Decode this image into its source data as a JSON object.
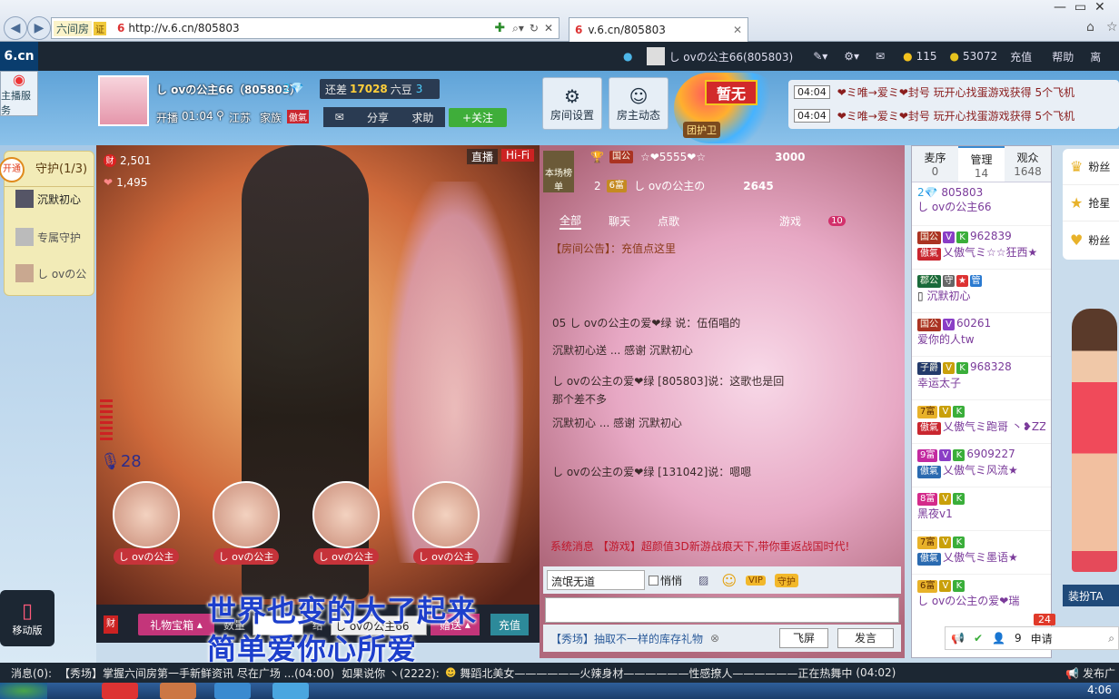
{
  "browser": {
    "fav_label": "六间房",
    "fav_badge": "证",
    "url": "http://v.6.cn/805803",
    "tab_title": "v.6.cn/805803"
  },
  "site": {
    "logo": "6.cn",
    "user": "し ovの公主66(805803)",
    "coins": "115",
    "beans": "53072",
    "recharge": "充值",
    "help": "帮助",
    "exit": "离"
  },
  "room": {
    "service": "主播服务",
    "name": "し ovの公主66（805803）",
    "diff_prefix": "还差",
    "diff_value": "17028",
    "diff_suffix": "六豆",
    "level": "3",
    "live_label": "开播",
    "live_time": "01:04",
    "location": "江苏",
    "family": "家族",
    "family_tag": "傲氣",
    "share": "分享",
    "request": "求助",
    "follow": "+关注",
    "btn_room_settings": "房间设置",
    "btn_host_feed": "房主动态",
    "no_guard": "暂无",
    "guard_group": "团护卫",
    "notices": [
      {
        "time": "04:04",
        "text": "❤ミ唯→爱ミ❤封号 玩开心找蛋游戏获得 5个飞机"
      },
      {
        "time": "04:04",
        "text": "❤ミ唯→爱ミ❤封号 玩开心找蛋游戏获得 5个飞机"
      }
    ]
  },
  "guard": {
    "open": "开通",
    "title": "守护(1/3)",
    "items": [
      "沉默初心",
      "专属守护",
      "し ovの公"
    ]
  },
  "video": {
    "wealth": "2,501",
    "hearts": "1,495",
    "live_tag": "直播",
    "hifi_tag": "Hi-Fi",
    "mic_count": "28",
    "gift_names": [
      "し ovの公主",
      "し ovの公主",
      "し ovの公主",
      "し ovの公主"
    ],
    "lyric1": "世界也变的大了起来",
    "lyric2": "简单爱你心所爱",
    "gift_box": "礼物宝箱",
    "qty_label": "数量",
    "to_label": "给",
    "recipient": "し ovの公主66",
    "send": "赠送",
    "recharge": "充值"
  },
  "rank": {
    "label": "本场榜单",
    "first_badge": "国公",
    "first_name": "☆❤5555❤☆",
    "first_score": "3000",
    "second_num": "2",
    "second_badge": "6富",
    "second_name": "し ovの公主の",
    "second_score": "2645"
  },
  "chat": {
    "tabs": [
      "全部",
      "聊天",
      "点歌",
      "游戏"
    ],
    "tab_count": "10",
    "announce": "【房间公告】：充值点这里",
    "messages": [
      "05 し ovの公主の爱❤绿   说：伍佰唱的",
      "沉默初心送 ...                     感谢 沉默初心",
      "し ovの公主の爱❤绿 [805803]说：这歌也是回",
      "那个差不多",
      "沉默初心 ...                         感谢 沉默初心",
      "し ovの公主の爱❤绿 [131042]说：嗯嗯"
    ],
    "system": "系统消息 【游戏】超颜值3D新游战痕天下,带你重返战国时代!",
    "target": "流氓无道",
    "whisper": "悄悄",
    "vip": "VIP",
    "guard_btn": "守护",
    "promo": "【秀场】抽取不一样的库存礼物",
    "fly": "飞屏",
    "send": "发言"
  },
  "users": {
    "tabs": [
      {
        "label": "麦序",
        "count": "0"
      },
      {
        "label": "管理",
        "count": "14"
      },
      {
        "label": "观众",
        "count": "1648"
      }
    ],
    "host_id": "805803",
    "host_name": "し ovの公主66",
    "rows": [
      {
        "badge": "国公",
        "id": "962839",
        "tag": "傲氣",
        "name": "乂傲气ミ☆☆狂西★"
      },
      {
        "badge": "郡公",
        "id": "",
        "tag": "",
        "name": "沉默初心"
      },
      {
        "badge": "国公",
        "id": "60261",
        "tag": "",
        "name": "爱你的人tw"
      },
      {
        "badge": "子爵",
        "id": "968328",
        "tag": "",
        "name": "幸运太子"
      },
      {
        "badge": "7富",
        "id": "",
        "tag": "傲氣",
        "name": "乂傲气ミ跑哥 丶❥ZZ"
      },
      {
        "badge": "9富",
        "id": "6909227",
        "tag": "傲氣",
        "name": "乂傲气ミ风流★"
      },
      {
        "badge": "8富",
        "id": "",
        "tag": "",
        "name": "黑夜v1"
      },
      {
        "badge": "7富",
        "id": "",
        "tag": "傲氣",
        "name": "乂傲气ミ墨语★"
      },
      {
        "badge": "6富",
        "id": "",
        "tag": "",
        "name": "し ovの公主の爱❤瑞"
      }
    ],
    "online": "9",
    "apply": "申请",
    "badge_count": "24"
  },
  "right": {
    "items": [
      "粉丝",
      "抢星",
      "粉丝"
    ],
    "dress": "装扮TA"
  },
  "mobile": "移动版",
  "bottom": {
    "msg_label": "消息(0):",
    "ticker": "【秀场】掌握六间房第一手新鲜资讯 尽在广场 ...(04:00)",
    "ticker2": "如果说你 ヽ(2222):",
    "ticker3": "舞蹈北美女——————火辣身材——————性感撩人——————正在热舞中",
    "time": "(04:02)",
    "publish": "发布广"
  },
  "clock": "4:06",
  "colors": {
    "header": "#1c2733",
    "room": "#5fa3d8",
    "accent": "#c6333a",
    "green": "#3fae3a"
  }
}
